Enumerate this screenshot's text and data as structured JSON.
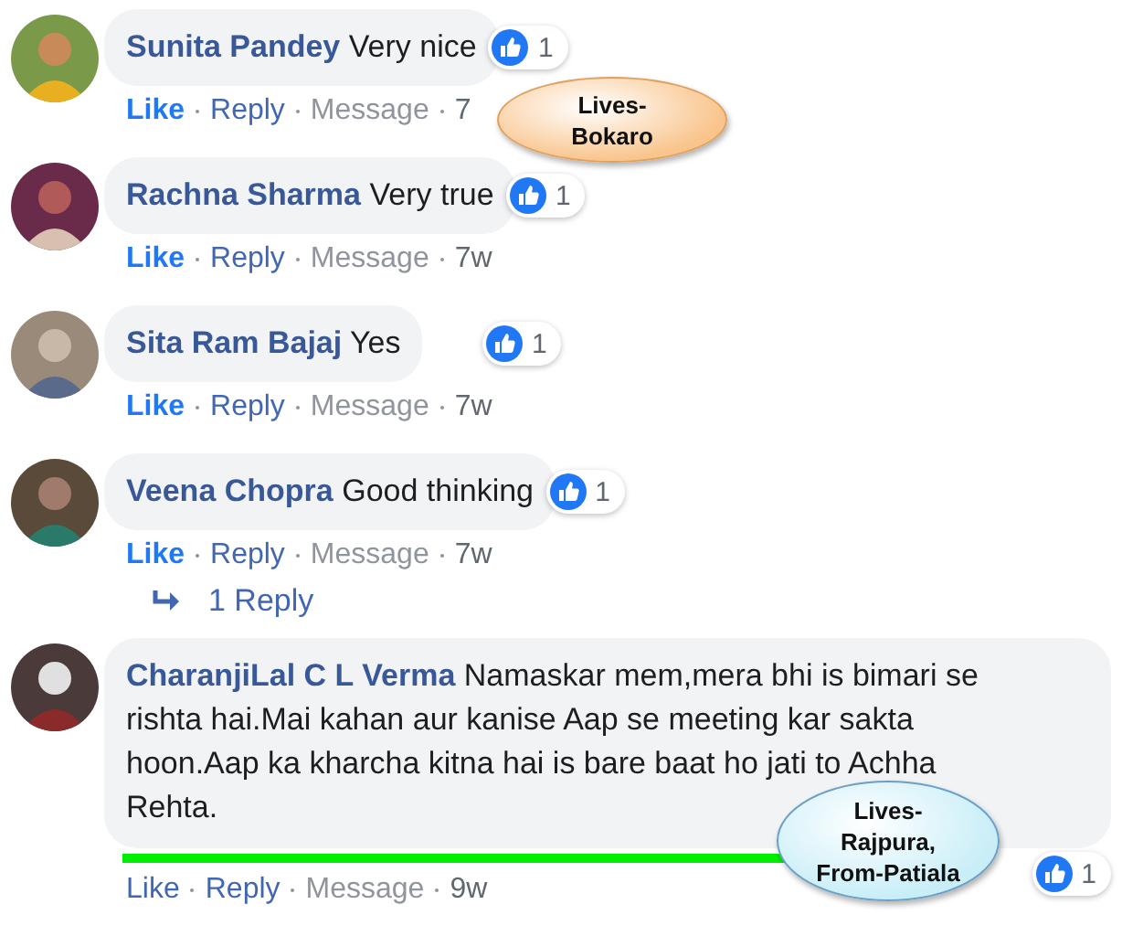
{
  "comments": [
    {
      "kind": "short",
      "author": "Sunita Pandey",
      "text": "Very nice",
      "likes": "1",
      "liked": true,
      "actions": [
        "Like",
        "Reply",
        "Message"
      ],
      "time": "7",
      "callout": {
        "text": "Lives-\nBokaro",
        "color": "#f9c58d"
      }
    },
    {
      "kind": "short",
      "author": "Rachna Sharma",
      "text": "Very true",
      "likes": "1",
      "liked": true,
      "actions": [
        "Like",
        "Reply",
        "Message"
      ],
      "time": "7w"
    },
    {
      "kind": "short",
      "author": "Sita Ram Bajaj",
      "text": "Yes",
      "likes": "1",
      "liked": true,
      "actions": [
        "Like",
        "Reply",
        "Message"
      ],
      "time": "7w"
    },
    {
      "kind": "short",
      "author": "Veena Chopra",
      "text": "Good thinking",
      "likes": "1",
      "liked": true,
      "actions": [
        "Like",
        "Reply",
        "Message"
      ],
      "time": "7w",
      "replies_link": "1 Reply"
    },
    {
      "kind": "long",
      "author": "CharanjiLal C L Verma",
      "text": "Namaskar mem,mera bhi is bimari se rishta hai.Mai kahan aur kanise Aap se meeting kar sakta hoon.Aap ka kharcha kitna hai is bare baat ho jati to Achha Rehta.",
      "likes": "1",
      "liked": false,
      "underlined": true,
      "actions": [
        "Like",
        "Reply",
        "Message"
      ],
      "time": "9w",
      "callout": {
        "text": "Lives-\nRajpura,\nFrom-Patiala",
        "color": "#c9eef8"
      }
    }
  ]
}
